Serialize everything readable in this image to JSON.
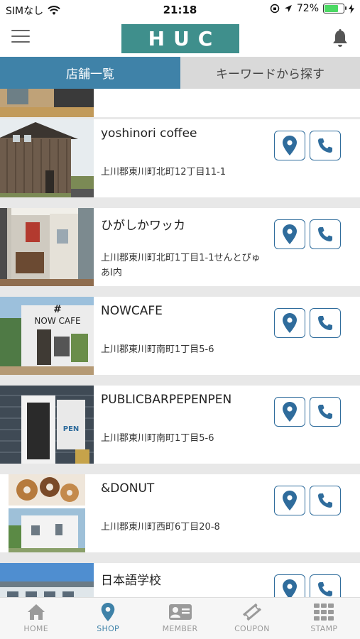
{
  "status_bar": {
    "carrier": "SIMなし",
    "time": "21:18",
    "battery_percent": "72%",
    "battery_level": 0.72
  },
  "header": {
    "logo": "HUC",
    "menu_icon": "hamburger-menu-icon",
    "notification_icon": "bell-icon"
  },
  "tabs": [
    {
      "label": "店舗一覧",
      "active": true
    },
    {
      "label": "キーワードから探す",
      "active": false
    }
  ],
  "shops": [
    {
      "name": "yoshinori coffee",
      "address": "上川郡東川町北町12丁目11-1"
    },
    {
      "name": "ひがしかワッカ",
      "address": "上川郡東川町北町1丁目1-1せんとぴゅあⅠ内"
    },
    {
      "name": "NOWCAFE",
      "address": "上川郡東川町南町1丁目5-6"
    },
    {
      "name": "PUBLICBARPEPENPEN",
      "address": "上川郡東川町南町1丁目5-6"
    },
    {
      "name": "&DONUT",
      "address": "上川郡東川町西町6丁目20-8"
    },
    {
      "name": "日本語学校",
      "address": ""
    }
  ],
  "image_text": {
    "nowcafe_sign_hash": "#",
    "nowcafe_sign": "NOW CAFE",
    "pen_sign": "PEN"
  },
  "bottom_nav": [
    {
      "label": "HOME",
      "icon": "home-icon",
      "active": false
    },
    {
      "label": "SHOP",
      "icon": "map-pin-icon",
      "active": true
    },
    {
      "label": "MEMBER",
      "icon": "member-card-icon",
      "active": false
    },
    {
      "label": "COUPON",
      "icon": "coupon-ticket-icon",
      "active": false
    },
    {
      "label": "STAMP",
      "icon": "stamp-grid-icon",
      "active": false
    }
  ],
  "colors": {
    "brand_teal": "#3f8f8c",
    "tab_active": "#3f82a8",
    "tab_inactive": "#d9d9d9",
    "action_border": "#2f6c9c",
    "nav_active": "#3f82a8",
    "nav_inactive": "#9a9a9a",
    "battery_fill": "#4cd964"
  }
}
